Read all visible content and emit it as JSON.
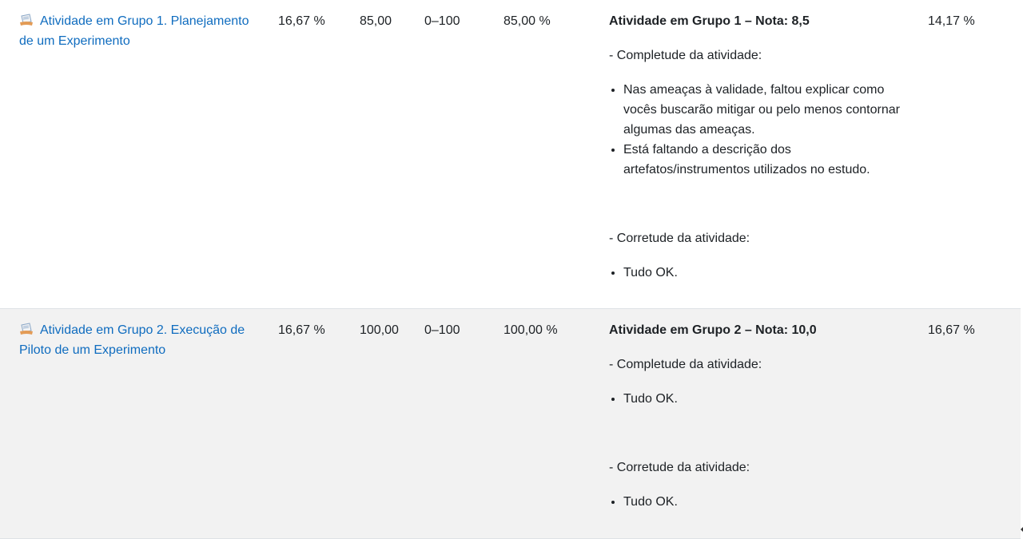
{
  "rows": [
    {
      "item": "Atividade em Grupo 1. Planejamento de um Experimento",
      "weight": "16,67 %",
      "grade": "85,00",
      "range": "0–100",
      "percentage": "85,00 %",
      "feedback": {
        "title": "Atividade em Grupo 1 – Nota: 8,5",
        "section1": "- Completude da atividade:",
        "section1_items": [
          "Nas ameaças à validade, faltou explicar como vocês buscarão mitigar ou pelo menos contornar algumas das ameaças.",
          "Está faltando a descrição dos artefatos/instrumentos utilizados no estudo."
        ],
        "section2": "- Corretude da atividade:",
        "section2_items": [
          "Tudo OK."
        ]
      },
      "contribution": "14,17 %"
    },
    {
      "item": "Atividade em Grupo 2. Execução de Piloto de um Experimento",
      "weight": "16,67 %",
      "grade": "100,00",
      "range": "0–100",
      "percentage": "100,00 %",
      "feedback": {
        "title": "Atividade em Grupo 2 – Nota: 10,0",
        "section1": "- Completude da atividade:",
        "section1_items": [
          "Tudo OK."
        ],
        "section2": "- Corretude da atividade:",
        "section2_items": [
          "Tudo OK."
        ]
      },
      "contribution": "16,67 %"
    }
  ],
  "icons": {
    "item": "assignment-icon"
  },
  "colors": {
    "link": "#0f6cbf",
    "row_alt": "#f2f2f2"
  }
}
